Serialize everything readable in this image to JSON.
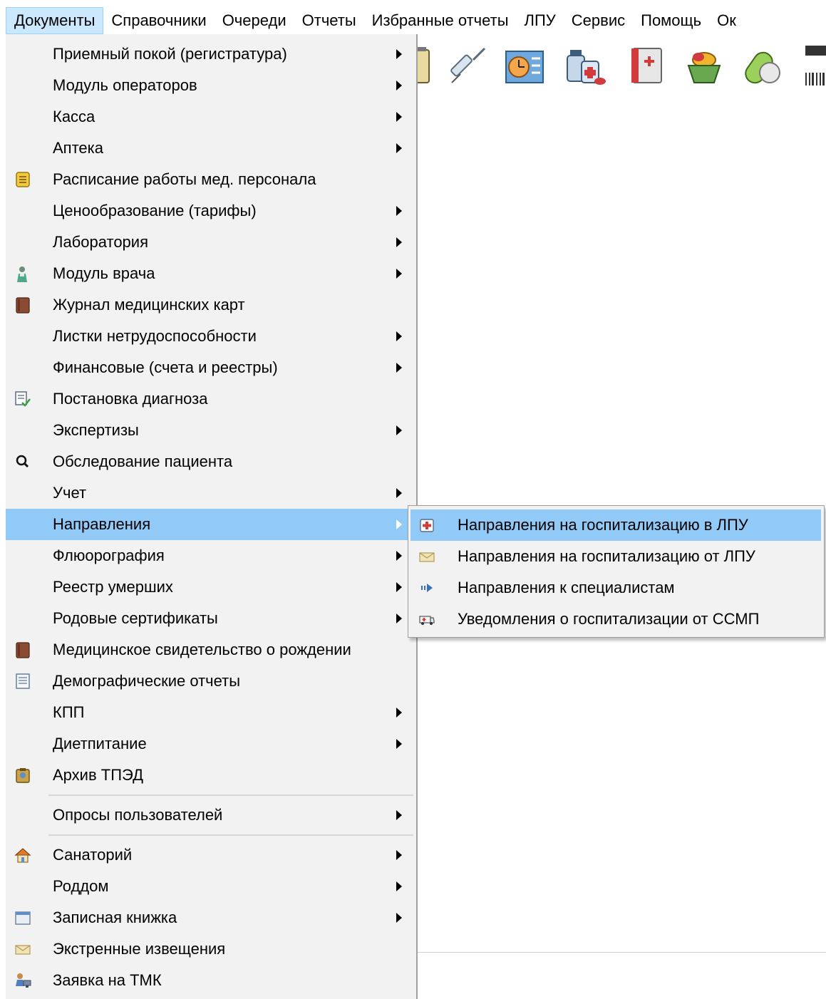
{
  "menubar": {
    "items": [
      "Документы",
      "Справочники",
      "Очереди",
      "Отчеты",
      "Избранные отчеты",
      "ЛПУ",
      "Сервис",
      "Помощь",
      "Ок"
    ],
    "active_index": 0
  },
  "toolbar": {
    "icons": [
      "notepad-icon",
      "syringe-icon",
      "schedule-icon",
      "medicine-bottles-icon",
      "medical-book-icon",
      "pills-basket-icon",
      "capsule-icon",
      "barcode-scanner-icon"
    ]
  },
  "documents_menu": {
    "items": [
      {
        "label": "Приемный покой (регистратура)",
        "submenu": true,
        "icon": ""
      },
      {
        "label": "Модуль операторов",
        "submenu": true,
        "icon": ""
      },
      {
        "label": "Касса",
        "submenu": true,
        "icon": ""
      },
      {
        "label": "Аптека",
        "submenu": true,
        "icon": ""
      },
      {
        "label": "Расписание работы мед. персонала",
        "submenu": false,
        "icon": "schedule-icon"
      },
      {
        "label": "Ценообразование (тарифы)",
        "submenu": true,
        "icon": ""
      },
      {
        "label": "Лаборатория",
        "submenu": true,
        "icon": ""
      },
      {
        "label": "Модуль врача",
        "submenu": true,
        "icon": "doctor-icon"
      },
      {
        "label": "Журнал медицинских карт",
        "submenu": false,
        "icon": "journal-icon"
      },
      {
        "label": "Листки нетрудоспособности",
        "submenu": true,
        "icon": ""
      },
      {
        "label": "Финансовые (счета и реестры)",
        "submenu": true,
        "icon": ""
      },
      {
        "label": "Постановка диагноза",
        "submenu": false,
        "icon": "diagnosis-icon"
      },
      {
        "label": "Экспертизы",
        "submenu": true,
        "icon": ""
      },
      {
        "label": "Обследование пациента",
        "submenu": false,
        "icon": "search-icon"
      },
      {
        "label": "Учет",
        "submenu": true,
        "icon": ""
      },
      {
        "label": "Направления",
        "submenu": true,
        "icon": "",
        "highlighted": true
      },
      {
        "label": "Флюорография",
        "submenu": true,
        "icon": ""
      },
      {
        "label": "Реестр умерших",
        "submenu": true,
        "icon": ""
      },
      {
        "label": "Родовые сертификаты",
        "submenu": true,
        "icon": ""
      },
      {
        "label": "Медицинское свидетельство о рождении",
        "submenu": false,
        "icon": "journal-icon"
      },
      {
        "label": "Демографические отчеты",
        "submenu": false,
        "icon": "report-icon"
      },
      {
        "label": "КПП",
        "submenu": true,
        "icon": ""
      },
      {
        "label": "Диетпитание",
        "submenu": true,
        "icon": ""
      },
      {
        "label": "Архив ТПЭД",
        "submenu": false,
        "icon": "archive-icon"
      },
      {
        "label": "Опросы пользователей",
        "submenu": true,
        "icon": ""
      },
      {
        "label": "Санаторий",
        "submenu": true,
        "icon": "house-icon"
      },
      {
        "label": "Роддом",
        "submenu": true,
        "icon": ""
      },
      {
        "label": "Записная книжка",
        "submenu": true,
        "icon": "notebook-icon"
      },
      {
        "label": "Экстренные извещения",
        "submenu": false,
        "icon": "envelope-icon"
      },
      {
        "label": "Заявка на ТМК",
        "submenu": false,
        "icon": "telemedicine-icon"
      }
    ]
  },
  "referrals_submenu": {
    "items": [
      {
        "label": "Направления на госпитализацию в ЛПУ",
        "icon": "hospital-referral-icon",
        "highlighted": true
      },
      {
        "label": "Направления на госпитализацию от ЛПУ",
        "icon": "envelope-icon"
      },
      {
        "label": "Направления к специалистам",
        "icon": "arrow-right-icon"
      },
      {
        "label": "Уведомления о госпитализации от ССМП",
        "icon": "ambulance-icon"
      }
    ]
  },
  "colors": {
    "highlight": "#91c9f7",
    "menu_background": "#f2f2f2",
    "menubar_active": "#cce8ff"
  }
}
